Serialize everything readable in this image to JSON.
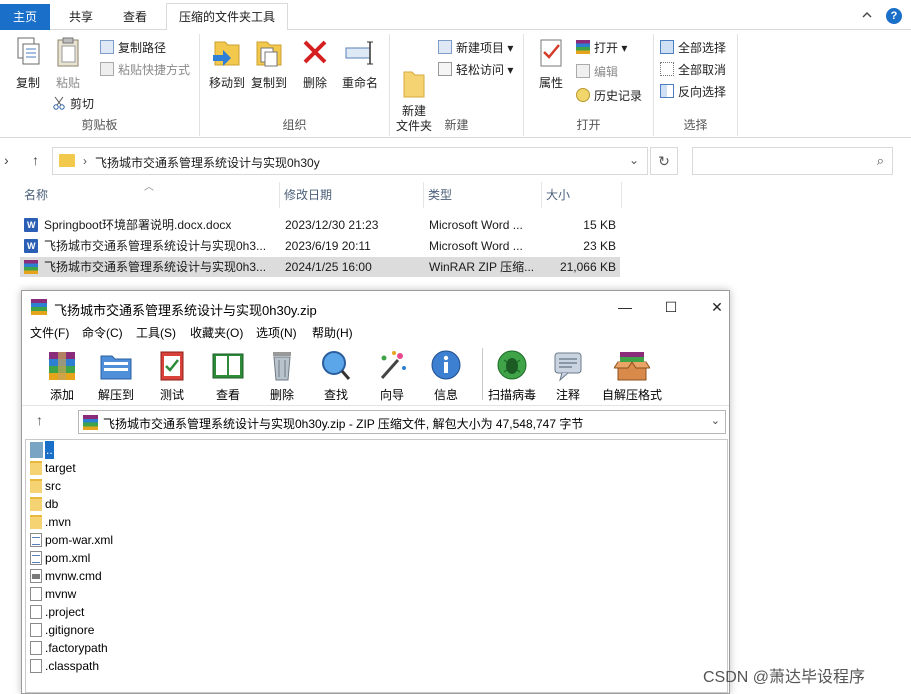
{
  "explorer": {
    "tabs": [
      {
        "label": "主页"
      },
      {
        "label": "共享"
      },
      {
        "label": "查看"
      },
      {
        "label": "压缩的文件夹工具"
      }
    ],
    "ribbon": {
      "clipboard": {
        "group_label": "剪贴板",
        "copy_label": "复制",
        "paste_label": "粘贴",
        "copy_path_label": "复制路径",
        "paste_shortcut_label": "粘贴快捷方式",
        "cut_label": "剪切"
      },
      "organize": {
        "group_label": "组织",
        "move_to_label": "移动到",
        "copy_to_label": "复制到",
        "delete_label": "删除",
        "rename_label": "重命名"
      },
      "new": {
        "group_label": "新建",
        "new_folder_label": "新建\n文件夹",
        "new_item_label": "新建项目",
        "easy_access_label": "轻松访问"
      },
      "open": {
        "group_label": "打开",
        "properties_label": "属性",
        "open_label": "打开",
        "edit_label": "编辑",
        "history_label": "历史记录"
      },
      "select": {
        "group_label": "选择",
        "select_all_label": "全部选择",
        "select_none_label": "全部取消",
        "invert_label": "反向选择"
      }
    },
    "address": {
      "path": "飞扬城市交通系管理系统设计与实现0h30y"
    },
    "columns": {
      "name": "名称",
      "modified": "修改日期",
      "type": "类型",
      "size": "大小"
    },
    "files": [
      {
        "name": "Springboot环境部署说明.docx.docx",
        "modified": "2023/12/30 21:23",
        "type": "Microsoft Word ...",
        "size": "15 KB",
        "icon": "word-icon"
      },
      {
        "name": "飞扬城市交通系管理系统设计与实现0h3...",
        "modified": "2023/6/19 20:11",
        "type": "Microsoft Word ...",
        "size": "23 KB",
        "icon": "word-icon"
      },
      {
        "name": "飞扬城市交通系管理系统设计与实现0h3...",
        "modified": "2024/1/25 16:00",
        "type": "WinRAR ZIP 压缩...",
        "size": "21,066 KB",
        "icon": "rar-icon"
      }
    ]
  },
  "winrar": {
    "title": "飞扬城市交通系管理系统设计与实现0h30y.zip",
    "menu": [
      "文件(F)",
      "命令(C)",
      "工具(S)",
      "收藏夹(O)",
      "选项(N)",
      "帮助(H)"
    ],
    "toolbar": [
      "添加",
      "解压到",
      "测试",
      "查看",
      "删除",
      "查找",
      "向导",
      "信息",
      "扫描病毒",
      "注释",
      "自解压格式"
    ],
    "path_text": "飞扬城市交通系管理系统设计与实现0h30y.zip - ZIP 压缩文件, 解包大小为 47,548,747 字节",
    "items": [
      {
        "name": "..",
        "icon": "up"
      },
      {
        "name": "target",
        "icon": "folder"
      },
      {
        "name": "src",
        "icon": "folder"
      },
      {
        "name": "db",
        "icon": "folder"
      },
      {
        "name": ".mvn",
        "icon": "folder"
      },
      {
        "name": "pom-war.xml",
        "icon": "xml"
      },
      {
        "name": "pom.xml",
        "icon": "xml"
      },
      {
        "name": "mvnw.cmd",
        "icon": "cmd"
      },
      {
        "name": "mvnw",
        "icon": "doc"
      },
      {
        "name": ".project",
        "icon": "doc"
      },
      {
        "name": ".gitignore",
        "icon": "doc"
      },
      {
        "name": ".factorypath",
        "icon": "doc"
      },
      {
        "name": ".classpath",
        "icon": "doc"
      }
    ]
  },
  "watermark": "CSDN @萧达毕设程序"
}
